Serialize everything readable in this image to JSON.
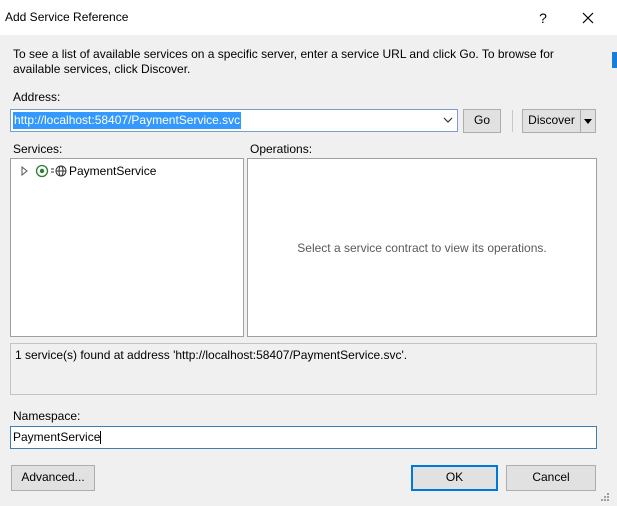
{
  "window": {
    "title": "Add Service Reference",
    "help_glyph": "?",
    "close_icon": "close-icon"
  },
  "description": "To see a list of available services on a specific server, enter a service URL and click Go. To browse for available services, click Discover.",
  "address": {
    "label": "Address:",
    "value": "http://localhost:58407/PaymentService.svc",
    "go_label": "Go",
    "discover_label": "Discover"
  },
  "services": {
    "label": "Services:",
    "items": [
      {
        "label": "PaymentService",
        "icon": "service-icon"
      }
    ]
  },
  "operations": {
    "label": "Operations:",
    "empty_message": "Select a service contract to view its operations."
  },
  "status": "1 service(s) found at address 'http://localhost:58407/PaymentService.svc'.",
  "namespace": {
    "label": "Namespace:",
    "value": "PaymentService"
  },
  "buttons": {
    "advanced": "Advanced...",
    "ok": "OK",
    "cancel": "Cancel"
  },
  "colors": {
    "selection": "#3399ff",
    "focus_border": "#0078d7",
    "dialog_bg": "#f0f0f0"
  }
}
